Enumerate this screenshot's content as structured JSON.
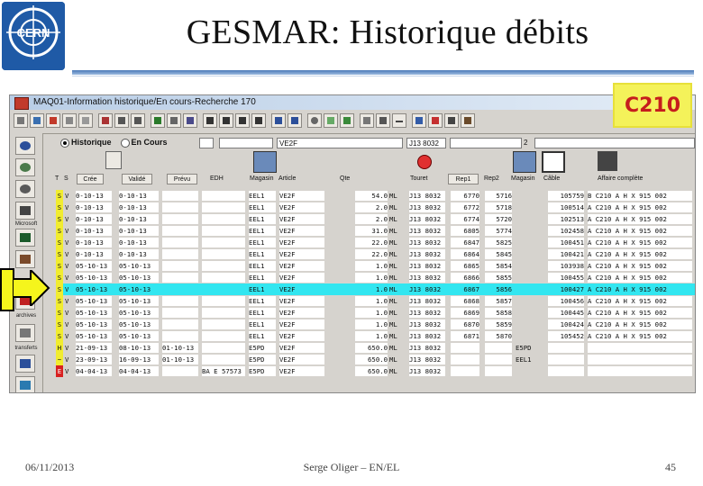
{
  "slide": {
    "title": "GESMAR: Historique débits",
    "badge": "C210",
    "footer_date": "06/11/2013",
    "footer_author": "Serge Oliger – EN/EL",
    "footer_page": "45",
    "logo_text": "CERN"
  },
  "window": {
    "title": "MAQ01-Information historique/En cours-Recherche 170"
  },
  "search": {
    "mode_historique": "Historique",
    "mode_en_cours": "En Cours",
    "article_value": "VE2F",
    "touret_value": "J13 8032",
    "count_value": "2"
  },
  "headers": {
    "t": "T",
    "s": "S",
    "cree": "Crée",
    "valide": "Validé",
    "prevu": "Prévu",
    "edh": "EDH",
    "magasin": "Magasin",
    "article": "Article",
    "qte": "Qte",
    "touret": "Touret",
    "rep1": "Rep1",
    "rep2": "Rep2",
    "magasin2": "Magasin",
    "cable": "Câble",
    "affaire": "Affaire complète"
  },
  "left_labels": {
    "microsoft": "Microsoft",
    "archives": "archives",
    "transferts": "transferts"
  },
  "rows": [
    {
      "t": "S",
      "s": "V",
      "cree": "0-10-13",
      "valide": "0-10-13",
      "prevu": "",
      "edh": "",
      "mag": "EEL1",
      "art": "VE2F",
      "qte": "54.0",
      "u": "ML",
      "tour": "J13 8032",
      "rep1": "6770",
      "rep2": "5716",
      "cable": "105759",
      "aff": "B C210  A H X 915 002",
      "hl": false
    },
    {
      "t": "S",
      "s": "V",
      "cree": "0-10-13",
      "valide": "0-10-13",
      "prevu": "",
      "edh": "",
      "mag": "EEL1",
      "art": "VE2F",
      "qte": "2.0",
      "u": "ML",
      "tour": "J13 8032",
      "rep1": "6772",
      "rep2": "5718",
      "cable": "100514",
      "aff": "A C210  A H X 915 002",
      "hl": false
    },
    {
      "t": "S",
      "s": "V",
      "cree": "0-10-13",
      "valide": "0-10-13",
      "prevu": "",
      "edh": "",
      "mag": "EEL1",
      "art": "VE2F",
      "qte": "2.0",
      "u": "ML",
      "tour": "J13 8032",
      "rep1": "6774",
      "rep2": "5720",
      "cable": "102513",
      "aff": "A C210  A H X 915 002",
      "hl": false
    },
    {
      "t": "S",
      "s": "V",
      "cree": "0-10-13",
      "valide": "0-10-13",
      "prevu": "",
      "edh": "",
      "mag": "EEL1",
      "art": "VE2F",
      "qte": "31.0",
      "u": "ML",
      "tour": "J13 8032",
      "rep1": "6805",
      "rep2": "5774",
      "cable": "102458",
      "aff": "A C210  A H X 915 002",
      "hl": false
    },
    {
      "t": "S",
      "s": "V",
      "cree": "0-10-13",
      "valide": "0-10-13",
      "prevu": "",
      "edh": "",
      "mag": "EEL1",
      "art": "VE2F",
      "qte": "22.0",
      "u": "ML",
      "tour": "J13 8032",
      "rep1": "6847",
      "rep2": "5825",
      "cable": "100451",
      "aff": "A C210  A H X 915 002",
      "hl": false
    },
    {
      "t": "S",
      "s": "V",
      "cree": "0-10-13",
      "valide": "0-10-13",
      "prevu": "",
      "edh": "",
      "mag": "EEL1",
      "art": "VE2F",
      "qte": "22.0",
      "u": "ML",
      "tour": "J13 8032",
      "rep1": "6864",
      "rep2": "5845",
      "cable": "100421",
      "aff": "A C210  A H X 915 002",
      "hl": false
    },
    {
      "t": "S",
      "s": "V",
      "cree": "05-10-13",
      "valide": "05-10-13",
      "prevu": "",
      "edh": "",
      "mag": "EEL1",
      "art": "VE2F",
      "qte": "1.0",
      "u": "ML",
      "tour": "J13 8032",
      "rep1": "6865",
      "rep2": "5854",
      "cable": "103938",
      "aff": "A C210  A H X 915 002",
      "hl": false
    },
    {
      "t": "S",
      "s": "V",
      "cree": "05-10-13",
      "valide": "05-10-13",
      "prevu": "",
      "edh": "",
      "mag": "EEL1",
      "art": "VE2F",
      "qte": "1.0",
      "u": "ML",
      "tour": "J13 8032",
      "rep1": "6866",
      "rep2": "5855",
      "cable": "100455",
      "aff": "A C210  A H X 915 002",
      "hl": false
    },
    {
      "t": "S",
      "s": "V",
      "cree": "05-10-13",
      "valide": "05-10-13",
      "prevu": "",
      "edh": "",
      "mag": "EEL1",
      "art": "VE2F",
      "qte": "1.0",
      "u": "ML",
      "tour": "J13 8032",
      "rep1": "6867",
      "rep2": "5856",
      "cable": "100427",
      "aff": "A C210  A H X 915 002",
      "hl": true
    },
    {
      "t": "S",
      "s": "V",
      "cree": "05-10-13",
      "valide": "05-10-13",
      "prevu": "",
      "edh": "",
      "mag": "EEL1",
      "art": "VE2F",
      "qte": "1.0",
      "u": "ML",
      "tour": "J13 8032",
      "rep1": "6868",
      "rep2": "5857",
      "cable": "100456",
      "aff": "A C210  A H X 915 002",
      "hl": false
    },
    {
      "t": "S",
      "s": "V",
      "cree": "05-10-13",
      "valide": "05-10-13",
      "prevu": "",
      "edh": "",
      "mag": "EEL1",
      "art": "VE2F",
      "qte": "1.0",
      "u": "ML",
      "tour": "J13 8032",
      "rep1": "6869",
      "rep2": "5858",
      "cable": "100445",
      "aff": "A C210  A H X 915 002",
      "hl": false
    },
    {
      "t": "S",
      "s": "V",
      "cree": "05-10-13",
      "valide": "05-10-13",
      "prevu": "",
      "edh": "",
      "mag": "EEL1",
      "art": "VE2F",
      "qte": "1.0",
      "u": "ML",
      "tour": "J13 8032",
      "rep1": "6870",
      "rep2": "5859",
      "cable": "100424",
      "aff": "A C210  A H X 915 002",
      "hl": false
    },
    {
      "t": "S",
      "s": "V",
      "cree": "05-10-13",
      "valide": "05-10-13",
      "prevu": "",
      "edh": "",
      "mag": "EEL1",
      "art": "VE2F",
      "qte": "1.0",
      "u": "ML",
      "tour": "J13 8032",
      "rep1": "6871",
      "rep2": "5870",
      "cable": "105452",
      "aff": "A C210  A H X 915 002",
      "hl": false
    },
    {
      "t": "H",
      "s": "V",
      "cree": "21-09-13",
      "valide": "08-10-13",
      "prevu": "01-10-13",
      "edh": "",
      "mag": "E5PD",
      "art": "VE2F",
      "qte": "650.0",
      "u": "ML",
      "tour": "J13 8032",
      "rep1": "",
      "rep2": "",
      "mag2": "E5PD",
      "cable": "",
      "aff": "",
      "hl": false
    },
    {
      "t": "~",
      "s": "V",
      "cree": "23-09-13",
      "valide": "16-09-13",
      "prevu": "01-10-13",
      "edh": "",
      "mag": "E5PD",
      "art": "VE2F",
      "qte": "650.0",
      "u": "ML",
      "tour": "J13 8032",
      "rep1": "",
      "rep2": "",
      "mag2": "EEL1",
      "cable": "",
      "aff": "",
      "hl": false
    },
    {
      "t": "E",
      "s": "V",
      "cree": "04-04-13",
      "valide": "04-04-13",
      "prevu": "",
      "edh": "BA E 57573",
      "mag": "E5PD",
      "art": "VE2F",
      "qte": "650.0",
      "u": "ML",
      "tour": "J13 8032",
      "rep1": "",
      "rep2": "",
      "cable": "",
      "aff": "",
      "hl": false
    }
  ]
}
